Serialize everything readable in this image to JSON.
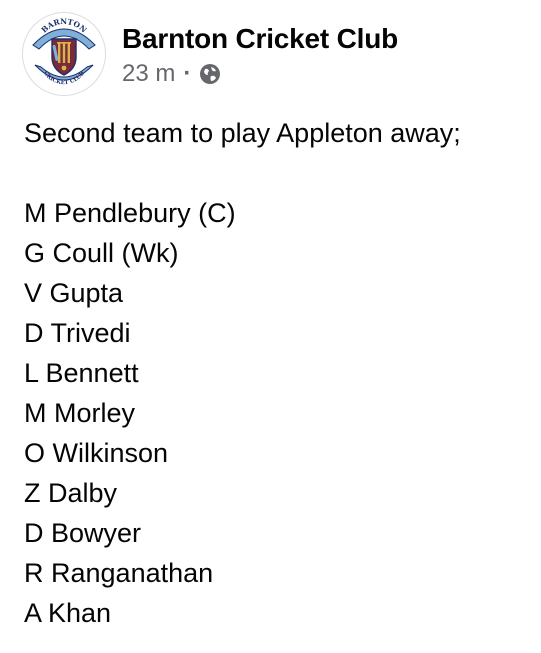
{
  "post": {
    "page_name": "Barnton Cricket Club",
    "timestamp": "23 m",
    "separator": "·",
    "audience_icon": "globe-icon",
    "intro": "Second team to play Appleton away;",
    "players": [
      "M Pendlebury (C)",
      "G Coull (Wk)",
      "V Gupta",
      "D Trivedi",
      "L Bennett",
      "M Morley",
      "O Wilkinson",
      "Z Dalby",
      "D Bowyer",
      "R Ranganathan",
      "A Khan"
    ]
  },
  "logo": {
    "top_text": "BARNTON",
    "bottom_text": "CRICKET CLUB",
    "colors": {
      "maroon": "#7b2a3a",
      "navy": "#1e2f6b",
      "gold": "#d9b44a",
      "sky": "#7fb0d9"
    }
  },
  "colors": {
    "text": "#050505",
    "secondary": "#65676b",
    "background": "#ffffff"
  }
}
